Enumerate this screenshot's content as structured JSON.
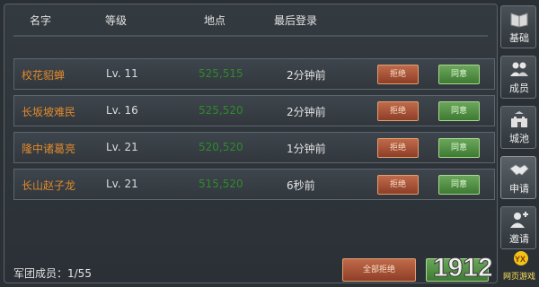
{
  "header": {
    "col_name": "名字",
    "col_level": "等级",
    "col_location": "地点",
    "col_last_login": "最后登录"
  },
  "rows": [
    {
      "name": "校花貂蝉",
      "level": "Lv. 11",
      "location": "525,515",
      "last_login": "2分钟前",
      "reject": "拒绝",
      "accept": "同意"
    },
    {
      "name": "长坂坡难民",
      "level": "Lv. 16",
      "location": "525,520",
      "last_login": "2分钟前",
      "reject": "拒绝",
      "accept": "同意"
    },
    {
      "name": "隆中诸葛亮",
      "level": "Lv. 21",
      "location": "520,520",
      "last_login": "1分钟前",
      "reject": "拒绝",
      "accept": "同意"
    },
    {
      "name": "长山赵子龙",
      "level": "Lv. 21",
      "location": "515,520",
      "last_login": "6秒前",
      "reject": "拒绝",
      "accept": "同意"
    }
  ],
  "footer": {
    "members_label": "军团成员：1/55",
    "reject_all": "全部拒绝"
  },
  "sidebar": [
    {
      "label": "基础",
      "icon": "book-icon"
    },
    {
      "label": "成员",
      "icon": "members-icon"
    },
    {
      "label": "城池",
      "icon": "castle-icon"
    },
    {
      "label": "申请",
      "icon": "handshake-icon",
      "active": true
    },
    {
      "label": "邀请",
      "icon": "add-user-icon"
    }
  ],
  "watermark": {
    "text": "1912",
    "badge": "YX",
    "sub": "网页游戏"
  },
  "colors": {
    "name": "#e08a2c",
    "location": "#2f8a2d",
    "reject": "#a84c32",
    "accept": "#4f8c42"
  }
}
